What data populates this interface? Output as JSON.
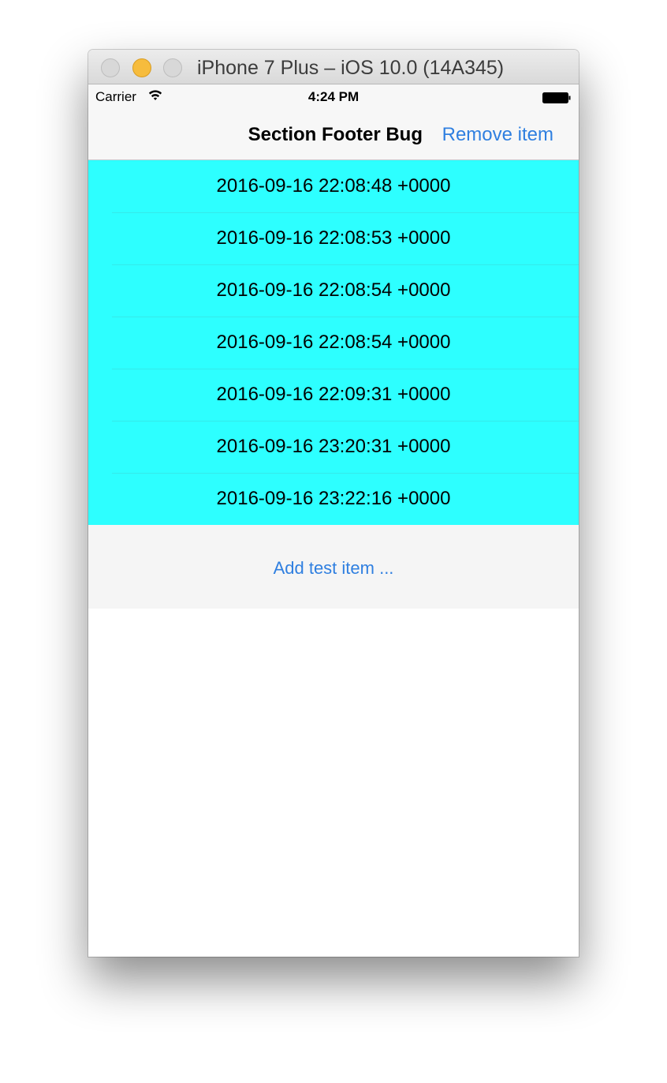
{
  "window": {
    "title": "iPhone 7 Plus – iOS 10.0 (14A345)"
  },
  "status_bar": {
    "carrier": "Carrier",
    "time": "4:24 PM"
  },
  "nav_bar": {
    "title": "Section Footer Bug",
    "right_button": "Remove item"
  },
  "table": {
    "rows": [
      "2016-09-16 22:08:48 +0000",
      "2016-09-16 22:08:53 +0000",
      "2016-09-16 22:08:54 +0000",
      "2016-09-16 22:08:54 +0000",
      "2016-09-16 22:09:31 +0000",
      "2016-09-16 23:20:31 +0000",
      "2016-09-16 23:22:16 +0000"
    ],
    "footer_button": "Add test item ..."
  },
  "colors": {
    "row_background": "#2dffff",
    "tint": "#2f7fe0",
    "footer_background": "#f5f5f5"
  },
  "icons": {
    "wifi": "wifi-icon",
    "battery": "battery-icon"
  }
}
